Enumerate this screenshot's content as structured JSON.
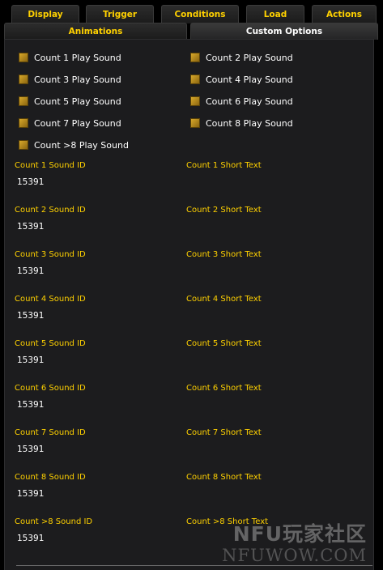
{
  "tabs_row1": [
    {
      "label": "Display",
      "active": false
    },
    {
      "label": "Trigger",
      "active": false
    },
    {
      "label": "Conditions",
      "active": false
    },
    {
      "label": "Load",
      "active": false
    },
    {
      "label": "Actions",
      "active": false
    }
  ],
  "tabs_row2": [
    {
      "label": "Animations",
      "active": false
    },
    {
      "label": "Custom Options",
      "active": true
    }
  ],
  "checkboxes": [
    {
      "label": "Count 1 Play Sound",
      "checked": true
    },
    {
      "label": "Count 2 Play Sound",
      "checked": true
    },
    {
      "label": "Count 3 Play Sound",
      "checked": true
    },
    {
      "label": "Count 4 Play Sound",
      "checked": true
    },
    {
      "label": "Count 5 Play Sound",
      "checked": true
    },
    {
      "label": "Count 6 Play Sound",
      "checked": true
    },
    {
      "label": "Count 7 Play Sound",
      "checked": true
    },
    {
      "label": "Count 8 Play Sound",
      "checked": true
    },
    {
      "label": "Count >8 Play Sound",
      "checked": true
    }
  ],
  "sound_fields": [
    {
      "label": "Count 1 Sound ID",
      "value": "15391"
    },
    {
      "label": "Count 2 Sound ID",
      "value": "15391"
    },
    {
      "label": "Count 3 Sound ID",
      "value": "15391"
    },
    {
      "label": "Count 4 Sound ID",
      "value": "15391"
    },
    {
      "label": "Count 5 Sound ID",
      "value": "15391"
    },
    {
      "label": "Count 6 Sound ID",
      "value": "15391"
    },
    {
      "label": "Count 7 Sound ID",
      "value": "15391"
    },
    {
      "label": "Count 8 Sound ID",
      "value": "15391"
    },
    {
      "label": "Count >8 Sound ID",
      "value": "15391"
    }
  ],
  "text_fields": [
    {
      "label": "Count 1 Short Text",
      "value": ""
    },
    {
      "label": "Count 2 Short Text",
      "value": ""
    },
    {
      "label": "Count 3 Short Text",
      "value": ""
    },
    {
      "label": "Count 4 Short Text",
      "value": ""
    },
    {
      "label": "Count 5 Short Text",
      "value": ""
    },
    {
      "label": "Count 6 Short Text",
      "value": ""
    },
    {
      "label": "Count 7 Short Text",
      "value": ""
    },
    {
      "label": "Count 8 Short Text",
      "value": ""
    },
    {
      "label": "Count >8 Short Text",
      "value": ""
    }
  ],
  "watermark": {
    "line1": "NFU玩家社区",
    "line2": "NFUWOW.COM"
  },
  "colors": {
    "label_gold": "#ffd100",
    "checkbox_gold": "#c8981f",
    "panel_bg": "#1c1c1e",
    "text_white": "#ffffff"
  }
}
